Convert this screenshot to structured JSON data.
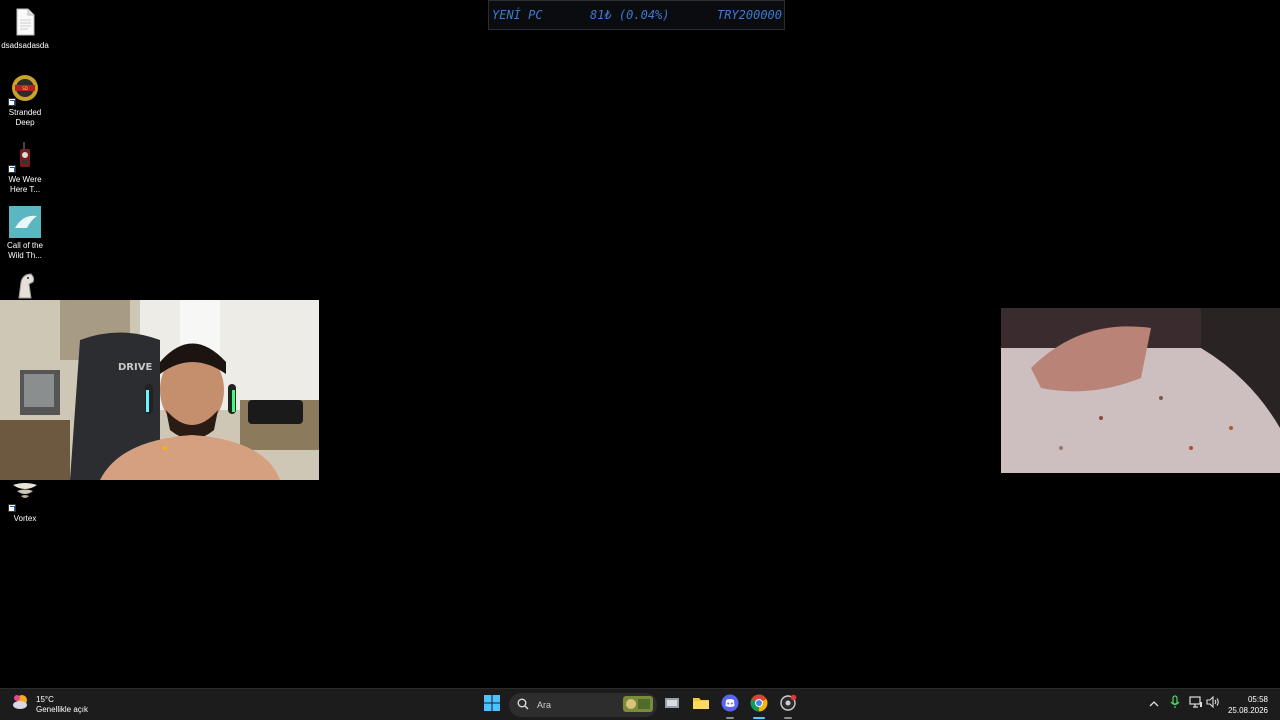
{
  "ticker": {
    "title": "YENİ PC",
    "amount": "81₺ (0.04%)",
    "goal": "TRY200000"
  },
  "desktop_icons": [
    {
      "label": "dsadsadasda",
      "icon": "document-icon"
    },
    {
      "label": "Stranded Deep",
      "icon": "stranded-deep-icon"
    },
    {
      "label": "We Were Here T...",
      "icon": "walkie-talkie-icon"
    },
    {
      "label": "Call of the Wild Th...",
      "icon": "call-of-the-wild-icon"
    },
    {
      "label": "",
      "icon": "horse-icon"
    },
    {
      "label": "Vortex",
      "icon": "vortex-icon"
    }
  ],
  "webcams": {
    "left": {
      "chair_brand": "DRIVE"
    }
  },
  "taskbar": {
    "weather": {
      "temp": "15°C",
      "condition": "Genellikle açık"
    },
    "search_placeholder": "Ara",
    "clock": {
      "time": "05:58",
      "date": "25.08.2026"
    }
  },
  "colors": {
    "ticker_text": "#3b7bd0",
    "taskbar_bg": "#1c1c1c",
    "desktop_bg": "#000000"
  }
}
